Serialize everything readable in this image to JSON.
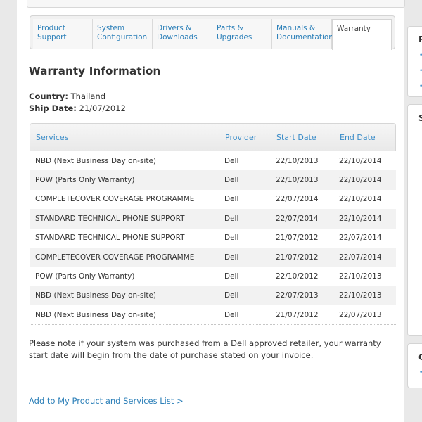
{
  "tabs": [
    {
      "line1": "Product",
      "line2": "Support"
    },
    {
      "line1": "System",
      "line2": "Configuration"
    },
    {
      "line1": "Drivers &",
      "line2": "Downloads"
    },
    {
      "line1": "Parts &",
      "line2": "Upgrades"
    },
    {
      "line1": "Manuals &",
      "line2": "Documentation"
    },
    {
      "line1": "Warranty",
      "line2": ""
    }
  ],
  "warranty": {
    "title": "Warranty Information",
    "country_label": "Country:",
    "country_value": "Thailand",
    "ship_date_label": "Ship Date:",
    "ship_date_value": "21/07/2012",
    "columns": [
      "Services",
      "Provider",
      "Start Date",
      "End Date"
    ],
    "rows": [
      [
        "NBD (Next Business Day on-site)",
        "Dell",
        "22/10/2013",
        "22/10/2014"
      ],
      [
        "POW (Parts Only Warranty)",
        "Dell",
        "22/10/2013",
        "22/10/2014"
      ],
      [
        "COMPLETECOVER COVERAGE PROGRAMME",
        "Dell",
        "22/07/2014",
        "22/10/2014"
      ],
      [
        "STANDARD TECHNICAL PHONE SUPPORT",
        "Dell",
        "22/07/2014",
        "22/10/2014"
      ],
      [
        "STANDARD TECHNICAL PHONE SUPPORT",
        "Dell",
        "21/07/2012",
        "22/07/2014"
      ],
      [
        "COMPLETECOVER COVERAGE PROGRAMME",
        "Dell",
        "21/07/2012",
        "22/07/2014"
      ],
      [
        "POW (Parts Only Warranty)",
        "Dell",
        "22/10/2012",
        "22/10/2013"
      ],
      [
        "NBD (Next Business Day on-site)",
        "Dell",
        "22/07/2013",
        "22/10/2013"
      ],
      [
        "NBD (Next Business Day on-site)",
        "Dell",
        "21/07/2012",
        "22/07/2013"
      ]
    ],
    "note": "Please note if your system was purchased from a Dell approved retailer, your warranty start date will begin from the date of purchase stated on your invoice.",
    "add_link": "Add to My Product and Services List >"
  },
  "sidebar": {
    "box1_char": "P",
    "box2_char": "S",
    "box3_char": "C"
  }
}
